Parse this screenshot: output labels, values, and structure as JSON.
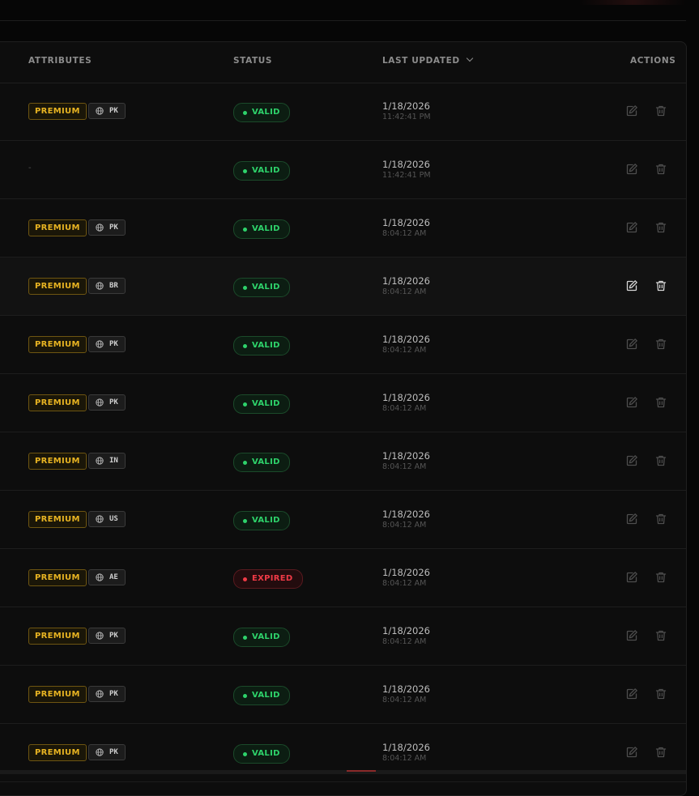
{
  "table": {
    "headers": {
      "attributes": "ATTRIBUTES",
      "status": "STATUS",
      "last_updated": "LAST UPDATED",
      "actions": "ACTIONS"
    },
    "rows": [
      {
        "premium": "PREMIUM",
        "country": "PK",
        "status": "VALID",
        "date": "1/18/2026",
        "time": "11:42:41 PM"
      },
      {
        "premium": "",
        "country": "",
        "empty": "-",
        "status": "VALID",
        "date": "1/18/2026",
        "time": "11:42:41 PM"
      },
      {
        "premium": "PREMIUM",
        "country": "PK",
        "status": "VALID",
        "date": "1/18/2026",
        "time": "8:04:12 AM"
      },
      {
        "premium": "PREMIUM",
        "country": "BR",
        "status": "VALID",
        "date": "1/18/2026",
        "time": "8:04:12 AM",
        "hover": true
      },
      {
        "premium": "PREMIUM",
        "country": "PK",
        "status": "VALID",
        "date": "1/18/2026",
        "time": "8:04:12 AM"
      },
      {
        "premium": "PREMIUM",
        "country": "PK",
        "status": "VALID",
        "date": "1/18/2026",
        "time": "8:04:12 AM"
      },
      {
        "premium": "PREMIUM",
        "country": "IN",
        "status": "VALID",
        "date": "1/18/2026",
        "time": "8:04:12 AM"
      },
      {
        "premium": "PREMIUM",
        "country": "US",
        "status": "VALID",
        "date": "1/18/2026",
        "time": "8:04:12 AM"
      },
      {
        "premium": "PREMIUM",
        "country": "AE",
        "status": "EXPIRED",
        "date": "1/18/2026",
        "time": "8:04:12 AM"
      },
      {
        "premium": "PREMIUM",
        "country": "PK",
        "status": "VALID",
        "date": "1/18/2026",
        "time": "8:04:12 AM"
      },
      {
        "premium": "PREMIUM",
        "country": "PK",
        "status": "VALID",
        "date": "1/18/2026",
        "time": "8:04:12 AM"
      },
      {
        "premium": "PREMIUM",
        "country": "PK",
        "status": "VALID",
        "date": "1/18/2026",
        "time": "8:04:12 AM"
      }
    ]
  },
  "icons": {
    "globe": "globe-icon",
    "edit": "edit-icon",
    "delete": "trash-icon",
    "sort": "chevron-down-icon"
  },
  "colors": {
    "background": "#060606",
    "panel": "#0d0d0d",
    "premium": "#e8b422",
    "valid": "#2ed36b",
    "expired": "#ef3a46"
  }
}
